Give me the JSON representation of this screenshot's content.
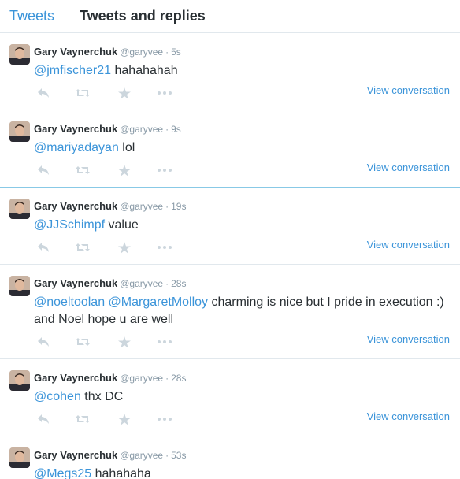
{
  "tabs": {
    "tweets": "Tweets",
    "replies": "Tweets and replies"
  },
  "colors": {
    "link": "#3b94d9",
    "muted": "#8899a6",
    "icon": "#ccd6dd",
    "divider": "#e1e8ed"
  },
  "tweets": [
    {
      "name": "Gary Vaynerchuk",
      "handle": "@garyvee",
      "sep": "·",
      "time": "5s",
      "mention1": "@jmfischer21",
      "mention2": "",
      "text": "hahahahah",
      "view": "View conversation"
    },
    {
      "name": "Gary Vaynerchuk",
      "handle": "@garyvee",
      "sep": "·",
      "time": "9s",
      "mention1": "@mariyadayan",
      "mention2": "",
      "text": "lol",
      "view": "View conversation"
    },
    {
      "name": "Gary Vaynerchuk",
      "handle": "@garyvee",
      "sep": "·",
      "time": "19s",
      "mention1": "@JJSchimpf",
      "mention2": "",
      "text": "value",
      "view": "View conversation"
    },
    {
      "name": "Gary Vaynerchuk",
      "handle": "@garyvee",
      "sep": "·",
      "time": "28s",
      "mention1": "@noeltoolan",
      "mention2": "@MargaretMolloy",
      "text": "charming is nice but I pride in execution :) and Noel hope u are well",
      "view": "View conversation"
    },
    {
      "name": "Gary Vaynerchuk",
      "handle": "@garyvee",
      "sep": "·",
      "time": "28s",
      "mention1": "@cohen",
      "mention2": "",
      "text": "thx DC",
      "view": "View conversation"
    },
    {
      "name": "Gary Vaynerchuk",
      "handle": "@garyvee",
      "sep": "·",
      "time": "53s",
      "mention1": "@Megs25",
      "mention2": "",
      "text": "hahahaha",
      "view": ""
    }
  ]
}
